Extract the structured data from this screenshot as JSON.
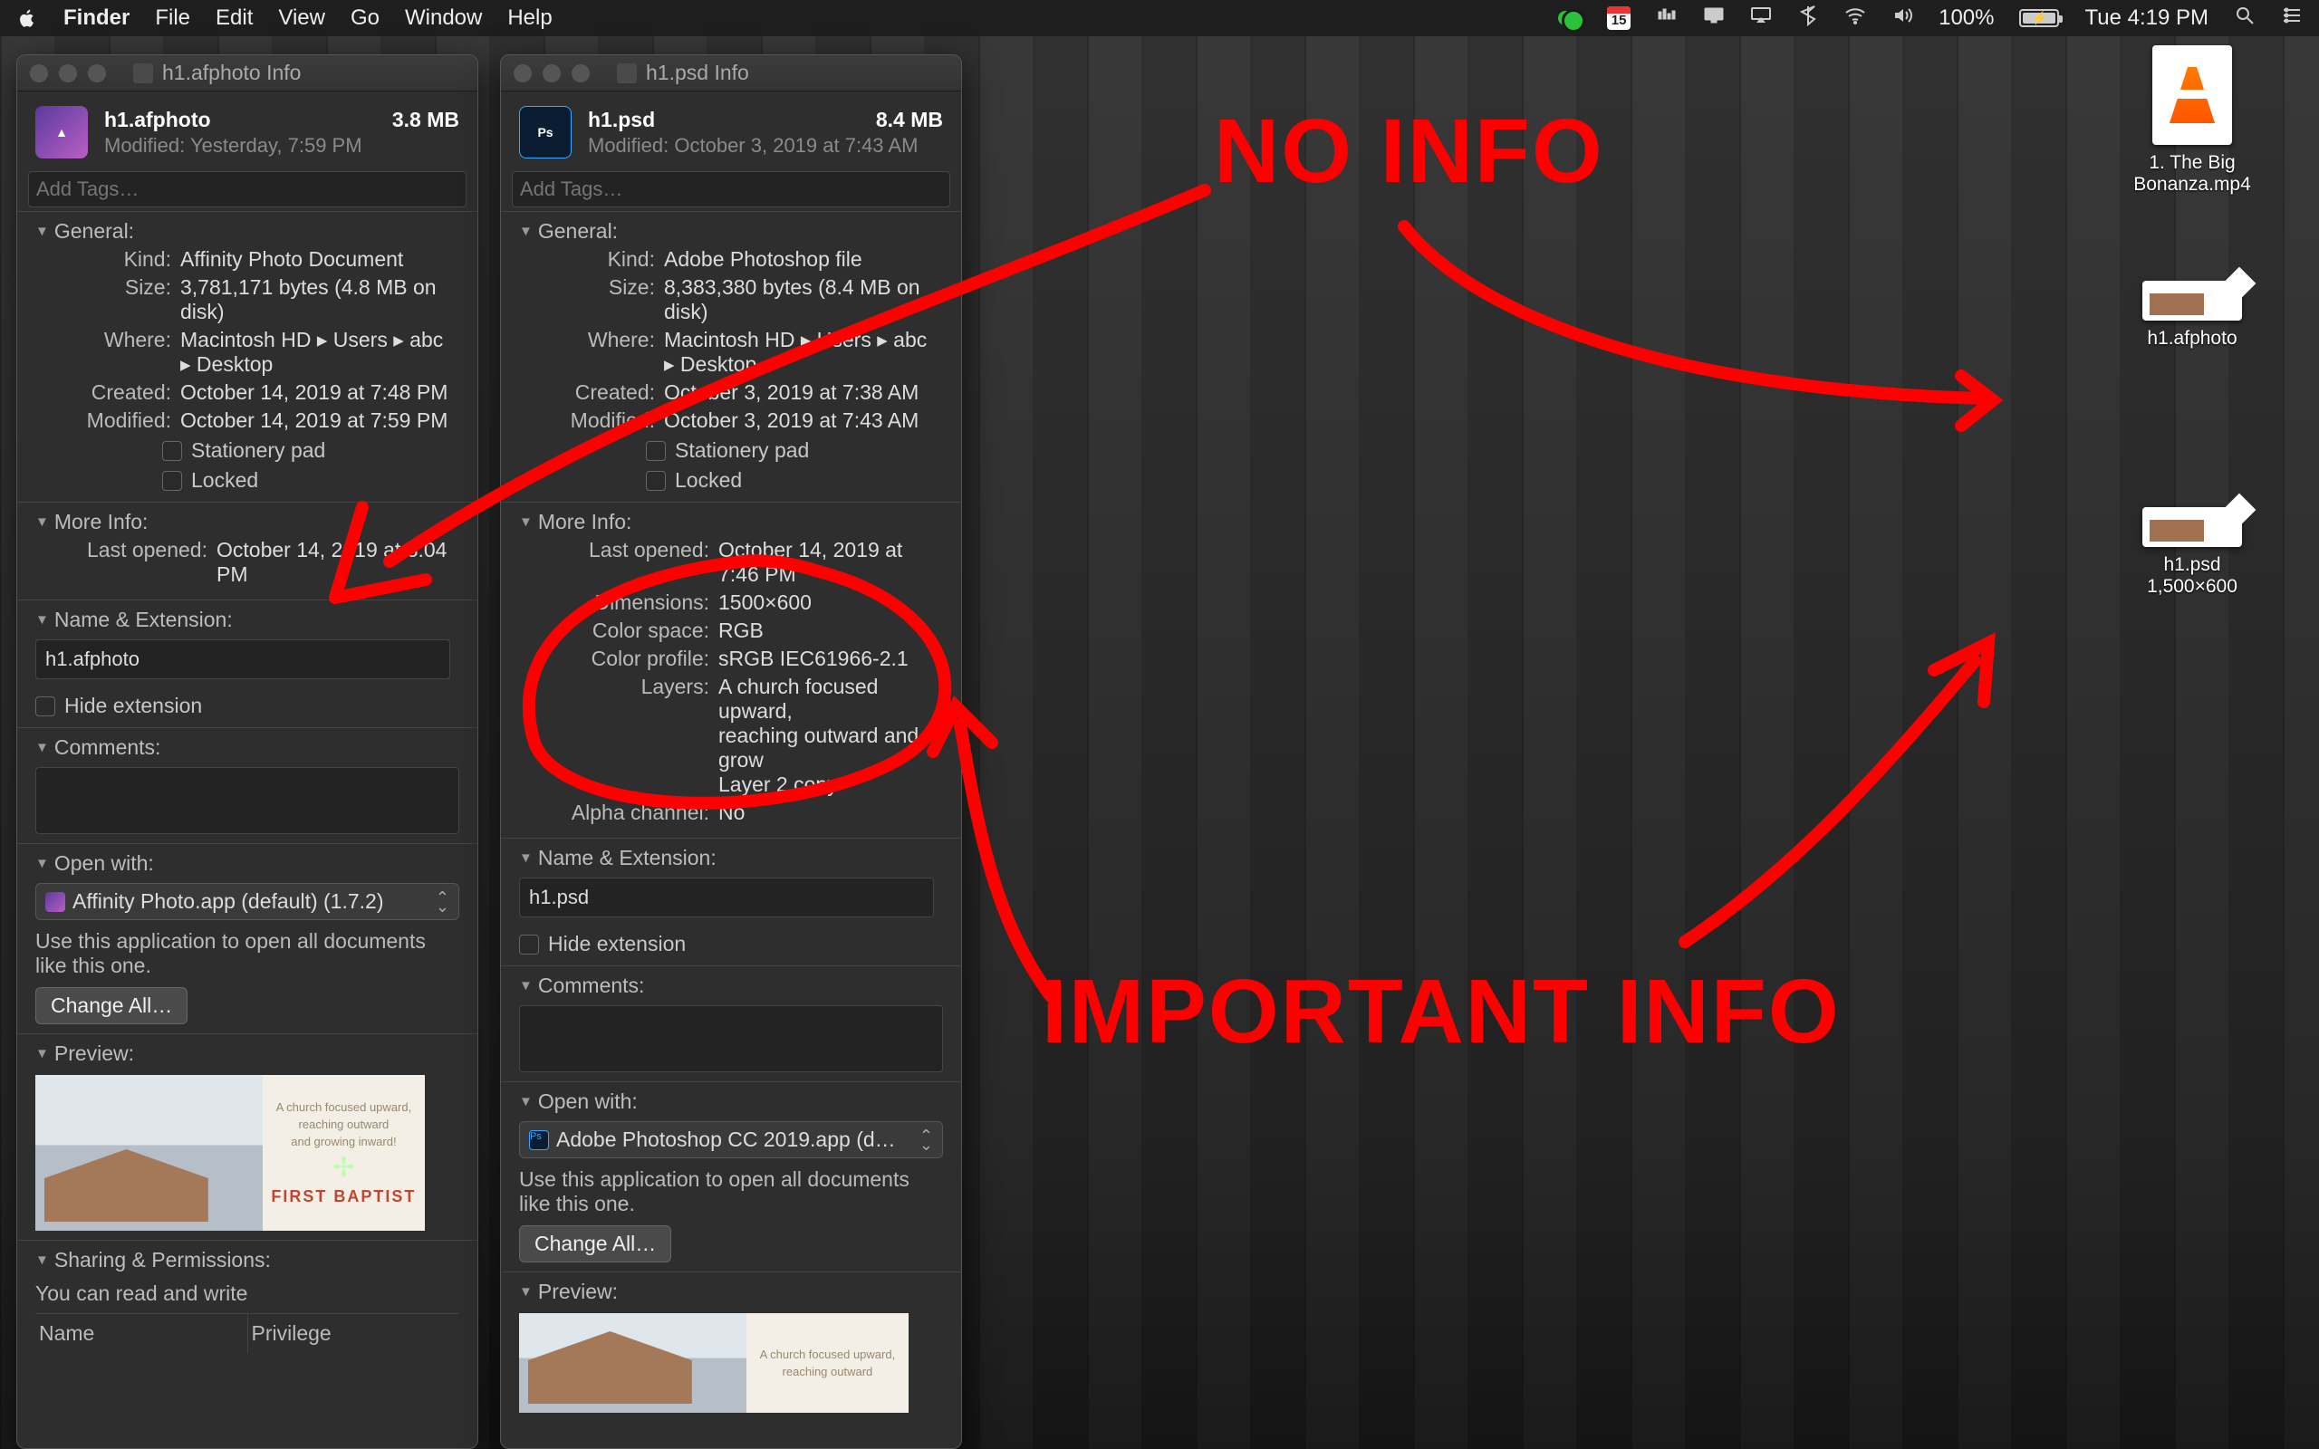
{
  "menubar": {
    "app": "Finder",
    "items": [
      "File",
      "Edit",
      "View",
      "Go",
      "Window",
      "Help"
    ],
    "cal_day": "15",
    "battery_pct": "100%",
    "clock": "Tue 4:19 PM"
  },
  "desktop": {
    "vlc": {
      "line1": "1. The Big",
      "line2": "Bonanza.mp4"
    },
    "afphoto": {
      "name": "h1.afphoto"
    },
    "psd": {
      "name": "h1.psd",
      "dims": "1,500×600"
    }
  },
  "annotations": {
    "no_info": "NO INFO",
    "important": "IMPORTANT INFO"
  },
  "preview_caption": {
    "t1a": "A church focused upward,",
    "t1b": "reaching outward",
    "t1c": "and growing inward!",
    "fb": "FIRST BAPTIST"
  },
  "common": {
    "add_tags": "Add Tags…",
    "general": "General:",
    "kind": "Kind:",
    "size": "Size:",
    "where": "Where:",
    "created": "Created:",
    "modified": "Modified:",
    "stationery": "Stationery pad",
    "locked": "Locked",
    "more_info": "More Info:",
    "last_opened": "Last opened:",
    "dimensions": "Dimensions:",
    "color_space": "Color space:",
    "color_profile": "Color profile:",
    "layers": "Layers:",
    "alpha": "Alpha channel:",
    "name_ext": "Name & Extension:",
    "hide_ext": "Hide extension",
    "comments": "Comments:",
    "open_with": "Open with:",
    "open_with_text": "Use this application to open all documents like this one.",
    "change_all": "Change All…",
    "preview": "Preview:",
    "sharing": "Sharing & Permissions:",
    "rw": "You can read and write",
    "col_name": "Name",
    "col_priv": "Privilege"
  },
  "win1": {
    "title": "h1.afphoto Info",
    "filename": "h1.afphoto",
    "filesize": "3.8 MB",
    "modified_short": "Modified: Yesterday, 7:59 PM",
    "kind": "Affinity Photo Document",
    "size": "3,781,171 bytes (4.8 MB on disk)",
    "where": "Macintosh HD ▸ Users ▸ abc ▸ Desktop",
    "created": "October 14, 2019 at 7:48 PM",
    "modified": "October 14, 2019 at 7:59 PM",
    "last_opened": "October 14, 2019 at 8:04 PM",
    "ext_value": "h1.afphoto",
    "open_with_app": "Affinity Photo.app (default) (1.7.2)"
  },
  "win2": {
    "title": "h1.psd Info",
    "filename": "h1.psd",
    "filesize": "8.4 MB",
    "modified_short": "Modified: October 3, 2019 at 7:43 AM",
    "kind": "Adobe Photoshop file",
    "size": "8,383,380 bytes (8.4 MB on disk)",
    "where": "Macintosh HD ▸ Users ▸ abc ▸ Desktop",
    "created": "October 3, 2019 at 7:38 AM",
    "modified": "October 3, 2019 at 7:43 AM",
    "last_opened": "October 14, 2019 at 7:46 PM",
    "dimensions": "1500×600",
    "color_space": "RGB",
    "color_profile": "sRGB IEC61966-2.1",
    "layers1": "A church focused upward,",
    "layers2": "reaching outward         and",
    "layers3": "grow",
    "layers4": "Layer 2 copy",
    "alpha": "No",
    "ext_value": "h1.psd",
    "open_with_app": "Adobe Photoshop CC 2019.app (d…"
  }
}
